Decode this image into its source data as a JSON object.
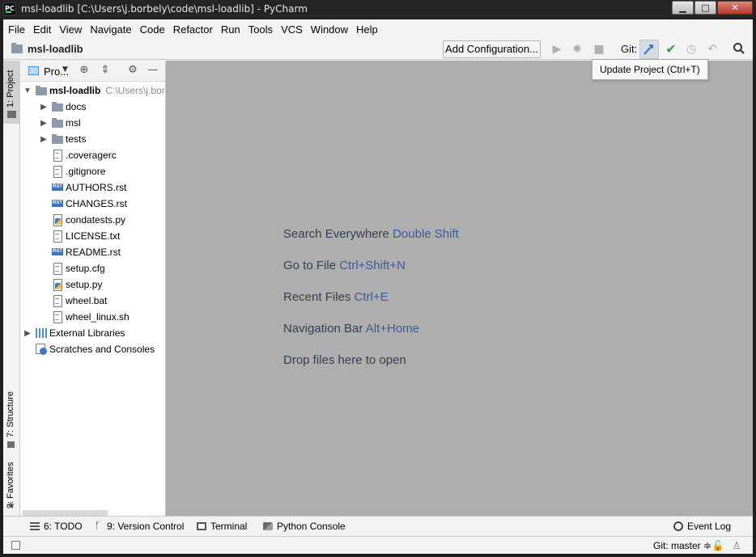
{
  "window": {
    "app_icon": "PC",
    "title": "msl-loadlib [C:\\Users\\j.borbely\\code\\msl-loadlib] - PyCharm",
    "minimize": "▁",
    "maximize": "□",
    "close": "✕"
  },
  "menu": [
    "File",
    "Edit",
    "View",
    "Navigate",
    "Code",
    "Refactor",
    "Run",
    "Tools",
    "VCS",
    "Window",
    "Help"
  ],
  "navbar": {
    "breadcrumb": "msl-loadlib",
    "add_configuration": "Add Configuration...",
    "git_label": "Git:",
    "icons": [
      "run-icon",
      "debug-icon",
      "stop-icon",
      "update-project-icon",
      "commit-icon",
      "history-icon",
      "rollback-icon",
      "search-icon"
    ]
  },
  "tooltip": "Update Project (Ctrl+T)",
  "left_stripe": {
    "project_tab": "1: Project",
    "structure_tab": "7: Structure",
    "favorites_tab": "2: Favorites"
  },
  "project_panel": {
    "title": "Pro...",
    "root_name": "msl-loadlib",
    "root_path": "C:\\Users\\j.bor",
    "items": [
      {
        "name": "docs",
        "type": "folder"
      },
      {
        "name": "msl",
        "type": "folder"
      },
      {
        "name": "tests",
        "type": "folder"
      },
      {
        "name": ".coveragerc",
        "type": "file"
      },
      {
        "name": ".gitignore",
        "type": "file"
      },
      {
        "name": "AUTHORS.rst",
        "type": "rst"
      },
      {
        "name": "CHANGES.rst",
        "type": "rst"
      },
      {
        "name": "condatests.py",
        "type": "py"
      },
      {
        "name": "LICENSE.txt",
        "type": "file"
      },
      {
        "name": "README.rst",
        "type": "rst"
      },
      {
        "name": "setup.cfg",
        "type": "file"
      },
      {
        "name": "setup.py",
        "type": "py"
      },
      {
        "name": "wheel.bat",
        "type": "file"
      },
      {
        "name": "wheel_linux.sh",
        "type": "file"
      }
    ],
    "external_libraries": "External Libraries",
    "scratches": "Scratches and Consoles"
  },
  "editor_hints": [
    {
      "text": "Search Everywhere",
      "key": "Double Shift"
    },
    {
      "text": "Go to File",
      "key": "Ctrl+Shift+N"
    },
    {
      "text": "Recent Files",
      "key": "Ctrl+E"
    },
    {
      "text": "Navigation Bar",
      "key": "Alt+Home"
    },
    {
      "text": "Drop files here to open",
      "key": ""
    }
  ],
  "bottom_tabs": {
    "todo": "6: TODO",
    "version_control": "9: Version Control",
    "terminal": "Terminal",
    "python_console": "Python Console",
    "event_log": "Event Log"
  },
  "status": {
    "git_branch": "Git: master ≑"
  },
  "colors": {
    "accent_key": "#3c5a9e",
    "editor_bg": "#aeaeae",
    "commit_green": "#3a9b3a",
    "update_blue": "#3b7fd4"
  }
}
